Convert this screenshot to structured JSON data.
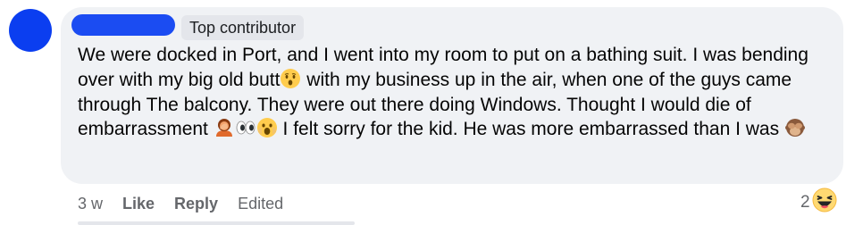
{
  "comment": {
    "author_badge": "Top contributor",
    "text": {
      "p1": "We were docked in Port, and I went into my room to put on a bathing suit. I was bending over with my big old butt",
      "p2": " with my business up in the air, when one of the guys came through The balcony. They were out there doing Windows. Thought I would die of embarrassment ",
      "p3": " I felt sorry for the kid. He was more embarrassed than I was "
    },
    "emojis": {
      "e1": "hushed-face-emoji",
      "e2": "person-facepalming-emoji",
      "e3": "eyes-emoji",
      "e4": "face-screaming-emoji",
      "e5": "see-no-evil-monkey-emoji"
    }
  },
  "actions": {
    "time": "3 w",
    "like_label": "Like",
    "reply_label": "Reply",
    "edited_label": "Edited"
  },
  "reactions": {
    "count": "2",
    "type": "haha-reaction-icon"
  },
  "colors": {
    "avatar": "#0b3ef0",
    "bubble": "#f0f2f5",
    "badge_bg": "#e4e6eb",
    "meta_text": "#65676b"
  }
}
